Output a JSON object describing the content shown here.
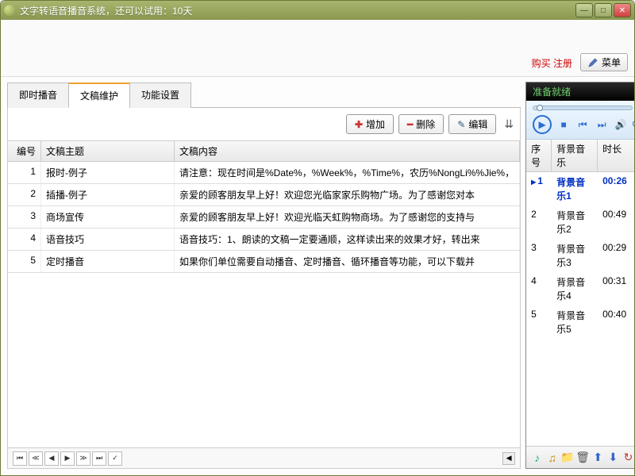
{
  "window": {
    "title": "文字转语音播音系统，还可以试用：10天"
  },
  "header": {
    "buy_register": "购买 注册",
    "menu": "菜单"
  },
  "tabs": [
    {
      "label": "即时播音",
      "active": false
    },
    {
      "label": "文稿维护",
      "active": true
    },
    {
      "label": "功能设置",
      "active": false
    }
  ],
  "toolbar": {
    "add": "增加",
    "delete": "删除",
    "edit": "编辑"
  },
  "grid": {
    "headers": {
      "num": "编号",
      "topic": "文稿主题",
      "content": "文稿内容"
    },
    "rows": [
      {
        "num": "1",
        "topic": "报时-例子",
        "content": "请注意：现在时间是%Date%，%Week%，%Time%，农历%NongLi%%Jie%，"
      },
      {
        "num": "2",
        "topic": "插播-例子",
        "content": "亲爱的顾客朋友早上好！欢迎您光临家家乐购物广场。为了感谢您对本"
      },
      {
        "num": "3",
        "topic": "商场宣传",
        "content": "亲爱的顾客朋友早上好！欢迎光临天虹购物商场。为了感谢您的支持与"
      },
      {
        "num": "4",
        "topic": "语音技巧",
        "content": "语音技巧：1、朗读的文稿一定要通顺，这样读出来的效果才好，转出来"
      },
      {
        "num": "5",
        "topic": "定时播音",
        "content": "如果你们单位需要自动播音、定时播音、循环播音等功能，可以下载并"
      }
    ]
  },
  "right": {
    "title": "准备就绪",
    "headers": {
      "num": "序号",
      "name": "背景音乐",
      "dur": "时长"
    },
    "rows": [
      {
        "num": "1",
        "name": "背景音乐1",
        "dur": "00:26",
        "sel": true
      },
      {
        "num": "2",
        "name": "背景音乐2",
        "dur": "00:49",
        "sel": false
      },
      {
        "num": "3",
        "name": "背景音乐3",
        "dur": "00:29",
        "sel": false
      },
      {
        "num": "4",
        "name": "背景音乐4",
        "dur": "00:31",
        "sel": false
      },
      {
        "num": "5",
        "name": "背景音乐5",
        "dur": "00:40",
        "sel": false
      }
    ]
  }
}
